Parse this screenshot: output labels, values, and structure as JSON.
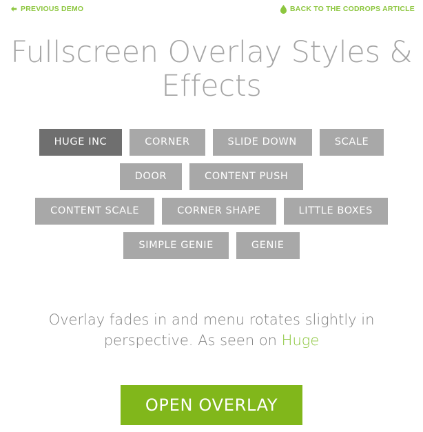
{
  "topbar": {
    "prev_demo": {
      "label": "PREVIOUS DEMO",
      "icon": "arrow-left-icon"
    },
    "back_article": {
      "label": "BACK TO THE CODROPS ARTICLE",
      "icon": "codrops-leaf-icon"
    },
    "link_color": "#8cc63e"
  },
  "header": {
    "title": "Fullscreen Overlay Styles & Effects"
  },
  "demos": {
    "rows": [
      [
        {
          "label": "HUGE INC",
          "current": true
        },
        {
          "label": "CORNER",
          "current": false
        },
        {
          "label": "SLIDE DOWN",
          "current": false
        },
        {
          "label": "SCALE",
          "current": false
        }
      ],
      [
        {
          "label": "DOOR",
          "current": false
        },
        {
          "label": "CONTENT PUSH",
          "current": false
        }
      ],
      [
        {
          "label": "CONTENT SCALE",
          "current": false
        },
        {
          "label": "CORNER SHAPE",
          "current": false
        },
        {
          "label": "LITTLE BOXES",
          "current": false
        }
      ],
      [
        {
          "label": "SIMPLE GENIE",
          "current": false
        },
        {
          "label": "GENIE",
          "current": false
        }
      ]
    ],
    "colors": {
      "inactive_bg": "#a8a8a8",
      "active_bg": "#6f6f6f",
      "label_color": "#ffffff"
    }
  },
  "description": {
    "text_before": "Overlay fades in and menu rotates slightly in perspective. As seen on ",
    "link_label": "Huge",
    "text_after": "",
    "text_color": "#808080",
    "link_color": "#8cc63e"
  },
  "cta": {
    "label": "OPEN OVERLAY",
    "bg_color": "#81b71b",
    "label_color": "#ffffff"
  }
}
